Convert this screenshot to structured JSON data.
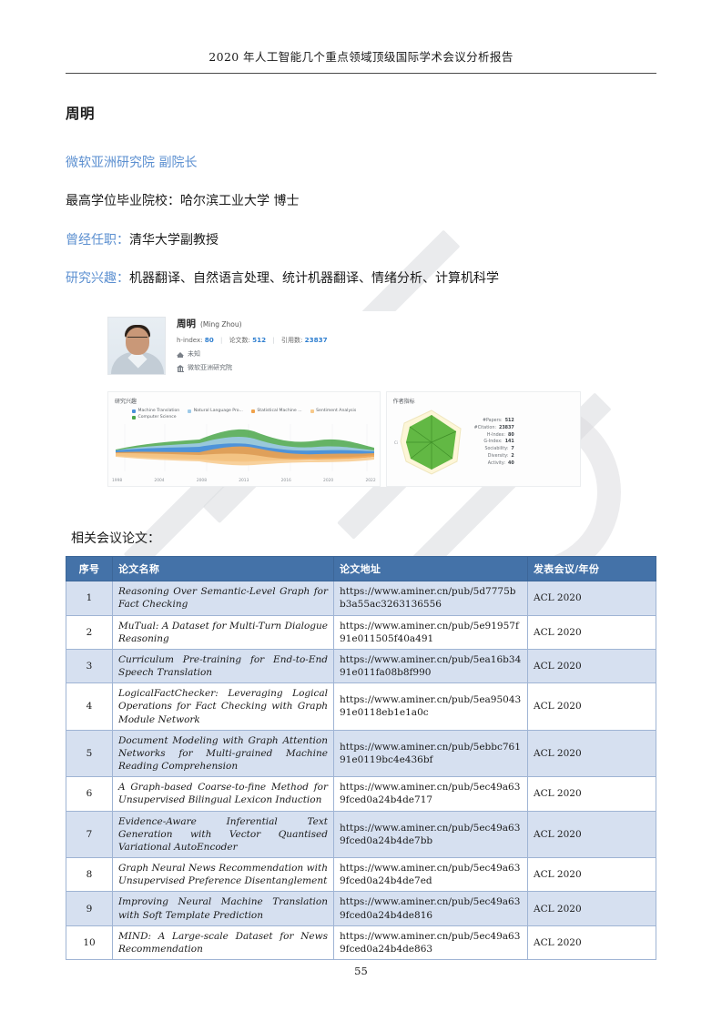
{
  "header": {
    "running_title": "2020 年人工智能几个重点领域顶级国际学术会议分析报告"
  },
  "person": {
    "name": "周明",
    "affiliation_line": "微软亚洲研究院  副院长",
    "degree_label": "最高学位毕业院校：",
    "degree_value": "哈尔滨工业大学  博士",
    "past_label": "曾经任职：",
    "past_value": "清华大学副教授",
    "interest_label": "研究兴趣：",
    "interest_value": "机器翻译、自然语言处理、统计机器翻译、情绪分析、计算机科学"
  },
  "profile_card": {
    "name_cn": "周明",
    "name_en": "(Ming Zhou)",
    "hindex_label": "h-index:",
    "hindex_value": "80",
    "papers_label": "论文数:",
    "papers_value": "512",
    "citations_label": "引用数:",
    "citations_value": "23837",
    "edu_row": "未知",
    "org_row": "微软亚洲研究院",
    "separator": "|",
    "accent_color": "#2f7fd0"
  },
  "charts": {
    "stream_title": "研究兴趣",
    "radar_title": "作者指标"
  },
  "chart_data": [
    {
      "type": "area",
      "title": "研究兴趣",
      "xlabel": "",
      "ylabel": "",
      "x": [
        "1998",
        "2004",
        "2008",
        "2013",
        "2016",
        "2020",
        "2022"
      ],
      "tick_labels": [
        "1998",
        "2004",
        "2008",
        "2013",
        "2016",
        "2020",
        "2022"
      ],
      "grid": true,
      "legend_position": "top",
      "series": [
        {
          "name": "Machine Translation",
          "color": "#4a90d9",
          "values": [
            4,
            12,
            10,
            20,
            14,
            9,
            6
          ]
        },
        {
          "name": "Natural Language Pro...",
          "color": "#9ecae8",
          "values": [
            3,
            7,
            9,
            18,
            12,
            10,
            8
          ]
        },
        {
          "name": "Statistical Machine ...",
          "color": "#f0a24b",
          "values": [
            1,
            4,
            7,
            17,
            11,
            7,
            4
          ]
        },
        {
          "name": "Sentiment Analysis",
          "color": "#f7c98b",
          "values": [
            0,
            2,
            4,
            9,
            6,
            4,
            3
          ]
        },
        {
          "name": "Computer Science",
          "color": "#4aa64a",
          "values": [
            2,
            5,
            6,
            13,
            10,
            12,
            9
          ]
        }
      ]
    },
    {
      "type": "radar",
      "title": "作者指标",
      "color": "#4caf2f",
      "categories": [
        "#Papers",
        "#Citation",
        "H-Index",
        "G-Index",
        "Sociability",
        "Diversity",
        "Activity"
      ],
      "values": [
        512,
        23837,
        80,
        141,
        7,
        2,
        40
      ],
      "axis_label": "Citation",
      "stats": [
        {
          "label": "#Papers:",
          "value": "512"
        },
        {
          "label": "#Citation:",
          "value": "23837"
        },
        {
          "label": "H-Index:",
          "value": "80"
        },
        {
          "label": "G-Index:",
          "value": "141"
        },
        {
          "label": "Sociability:",
          "value": "7"
        },
        {
          "label": "Diversity:",
          "value": "2"
        },
        {
          "label": "Activity:",
          "value": "40"
        }
      ]
    }
  ],
  "table": {
    "caption": "相关会议论文：",
    "header_color": "#4472a8",
    "columns": [
      "序号",
      "论文名称",
      "论文地址",
      "发表会议/年份"
    ],
    "rows": [
      {
        "num": "1",
        "title": "Reasoning Over Semantic-Level Graph for Fact Checking",
        "url": "https://www.aminer.cn/pub/5d7775bb3a55ac3263136556",
        "venue": "ACL 2020"
      },
      {
        "num": "2",
        "title": "MuTual: A Dataset for Multi-Turn Dialogue Reasoning",
        "url": "https://www.aminer.cn/pub/5e91957f91e011505f40a491",
        "venue": "ACL 2020"
      },
      {
        "num": "3",
        "title": "Curriculum Pre-training for End-to-End Speech Translation",
        "url": "https://www.aminer.cn/pub/5ea16b3491e011fa08b8f990",
        "venue": "ACL 2020"
      },
      {
        "num": "4",
        "title": "LogicalFactChecker: Leveraging Logical Operations for Fact Checking with Graph Module Network",
        "url": "https://www.aminer.cn/pub/5ea9504391e0118eb1e1a0c",
        "venue": "ACL 2020"
      },
      {
        "num": "5",
        "title": "Document Modeling with Graph Attention Networks for Multi-grained Machine Reading Comprehension",
        "url": "https://www.aminer.cn/pub/5ebbc76191e0119bc4e436bf",
        "venue": "ACL 2020"
      },
      {
        "num": "6",
        "title": "A Graph-based Coarse-to-fine Method for Unsupervised Bilingual Lexicon Induction",
        "url": "https://www.aminer.cn/pub/5ec49a639fced0a24b4de717",
        "venue": "ACL 2020"
      },
      {
        "num": "7",
        "title": "Evidence-Aware Inferential Text Generation with Vector Quantised Variational AutoEncoder",
        "url": "https://www.aminer.cn/pub/5ec49a639fced0a24b4de7bb",
        "venue": "ACL 2020"
      },
      {
        "num": "8",
        "title": "Graph Neural News Recommendation with Unsupervised Preference Disentanglement",
        "url": "https://www.aminer.cn/pub/5ec49a639fced0a24b4de7ed",
        "venue": "ACL 2020"
      },
      {
        "num": "9",
        "title": "Improving Neural Machine Translation with Soft Template Prediction",
        "url": "https://www.aminer.cn/pub/5ec49a639fced0a24b4de816",
        "venue": "ACL 2020"
      },
      {
        "num": "10",
        "title": "MIND: A Large-scale Dataset for News Recommendation",
        "url": "https://www.aminer.cn/pub/5ec49a639fced0a24b4de863",
        "venue": "ACL 2020"
      }
    ]
  },
  "footer": {
    "page_number": "55"
  }
}
